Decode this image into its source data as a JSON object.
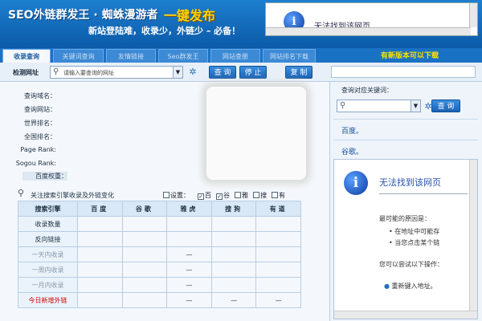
{
  "header": {
    "title": "SEO外链群发王 · 蜘蛛漫游者",
    "slogan": "一键发布",
    "subtitle": "新站登陆难，收录少，外链少 – 必备！"
  },
  "ad": {
    "text": "无法找到该网页"
  },
  "tabs": [
    "收录查询",
    "关键词查询",
    "友情链接",
    "Seo群发王",
    "网站查册",
    "网站排名下载"
  ],
  "new_version": "有新版本可以下载",
  "toolbar": {
    "url_label": "检测网址",
    "url_placeholder": "请输入要查询的网址",
    "query_button": "查 询",
    "stop_button": "停 止",
    "copy_button": "复 制"
  },
  "info_fields": [
    "查询域名：",
    "查询网站：",
    "世界排名：",
    "全国排名：",
    "Page Rank:",
    "Sogou Rank:",
    "百度权重："
  ],
  "results": {
    "title": "关注搜索引擎收录及外链变化",
    "settings_label": "设置：",
    "engines": [
      {
        "label": "百",
        "checked": true
      },
      {
        "label": "谷",
        "checked": true
      },
      {
        "label": "雅",
        "checked": false
      },
      {
        "label": "搜",
        "checked": false
      },
      {
        "label": "有",
        "checked": false
      }
    ],
    "columns": [
      "搜索引擎",
      "百度",
      "谷歌",
      "雅虎",
      "搜狗",
      "有道"
    ],
    "rows": [
      {
        "label": "收录数量",
        "cells": [
          "",
          "",
          "",
          "",
          ""
        ]
      },
      {
        "label": "反向链接",
        "cells": [
          "",
          "",
          "",
          "",
          ""
        ]
      },
      {
        "label": "一天内收录",
        "cells": [
          "",
          "",
          "—",
          "",
          ""
        ]
      },
      {
        "label": "一周内收录",
        "cells": [
          "",
          "",
          "—",
          "",
          ""
        ]
      },
      {
        "label": "一月内收录",
        "cells": [
          "",
          "",
          "—",
          "",
          ""
        ]
      },
      {
        "label": "今日新增外链",
        "cells": [
          "",
          "",
          "—",
          "—",
          "—"
        ]
      }
    ]
  },
  "right": {
    "keyword_title": "查询对应关键词：",
    "query_button": "查 询",
    "links": [
      "百度。",
      "谷歌。"
    ],
    "error": {
      "title": "无法找到该网页",
      "reasons_label": "最可能的原因是：",
      "bullets": [
        "在地址中可能存",
        "当您点击某个链"
      ],
      "try_label": "您可以尝试以下操作：",
      "action": "重新键入地址。"
    }
  },
  "colors": {
    "header": "#0b5aa8",
    "accent": "#ffd200",
    "link": "#1a4fa0",
    "warn": "#d00000"
  }
}
